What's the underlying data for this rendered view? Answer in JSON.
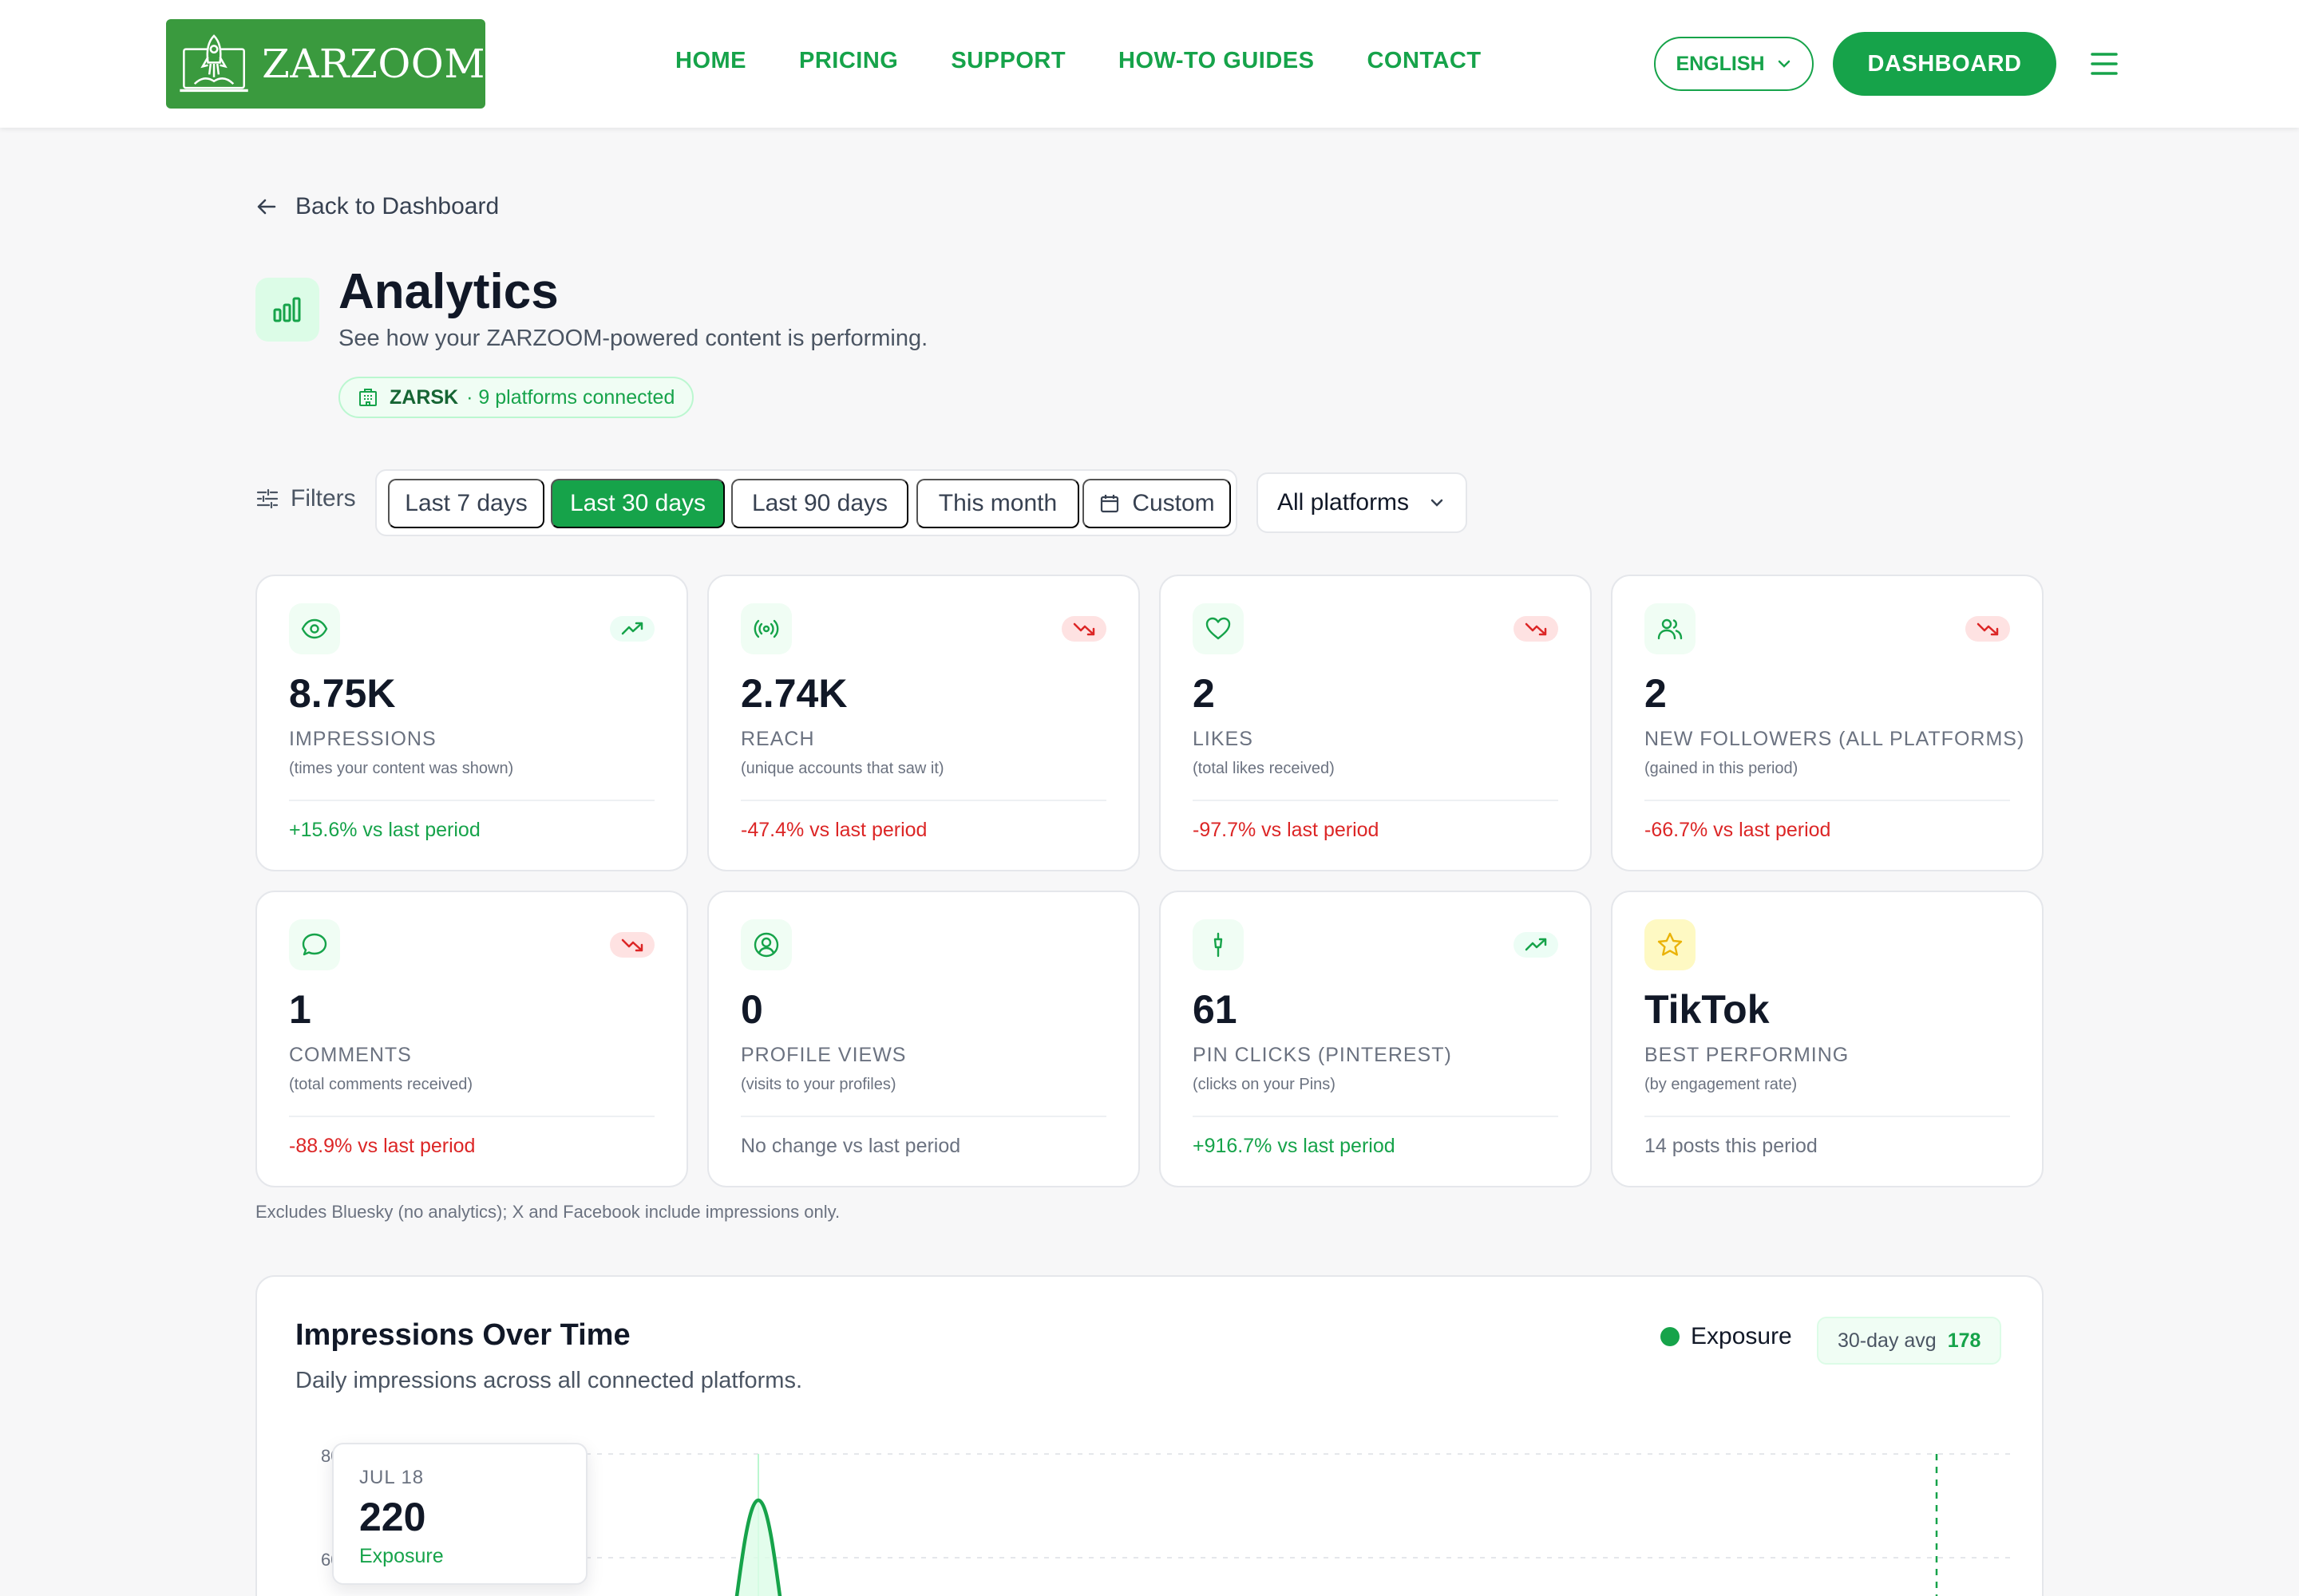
{
  "brand": {
    "logo_text": "ZARZOOM"
  },
  "nav": {
    "items": [
      {
        "label": "HOME"
      },
      {
        "label": "PRICING"
      },
      {
        "label": "SUPPORT"
      },
      {
        "label": "HOW-TO GUIDES"
      },
      {
        "label": "CONTACT"
      }
    ],
    "language": "ENGLISH",
    "dashboard_label": "DASHBOARD"
  },
  "page": {
    "back_label": "Back to Dashboard",
    "title": "Analytics",
    "subtitle": "See how your ZARZOOM-powered content is performing.",
    "org": {
      "name": "ZARSK",
      "meta": "· 9 platforms connected"
    }
  },
  "filters": {
    "label": "Filters",
    "ranges": [
      {
        "label": "Last 7 days",
        "active": false
      },
      {
        "label": "Last 30 days",
        "active": true
      },
      {
        "label": "Last 90 days",
        "active": false
      },
      {
        "label": "This month",
        "active": false
      },
      {
        "label": "Custom",
        "active": false
      }
    ],
    "platform": "All platforms"
  },
  "cards": [
    {
      "icon": "eye-icon",
      "trend": "up",
      "value": "8.75K",
      "label": "IMPRESSIONS",
      "desc": "(times your content was shown)",
      "change": "+15.6% vs last period",
      "change_type": "up"
    },
    {
      "icon": "broadcast-icon",
      "trend": "down",
      "value": "2.74K",
      "label": "REACH",
      "desc": "(unique accounts that saw it)",
      "change": "-47.4% vs last period",
      "change_type": "down"
    },
    {
      "icon": "heart-icon",
      "trend": "down",
      "value": "2",
      "label": "LIKES",
      "desc": "(total likes received)",
      "change": "-97.7% vs last period",
      "change_type": "down"
    },
    {
      "icon": "users-icon",
      "trend": "down",
      "value": "2",
      "label": "NEW FOLLOWERS (ALL PLATFORMS)",
      "desc": "(gained in this period)",
      "change": "-66.7% vs last period",
      "change_type": "down"
    },
    {
      "icon": "comment-icon",
      "trend": "down",
      "value": "1",
      "label": "COMMENTS",
      "desc": "(total comments received)",
      "change": "-88.9% vs last period",
      "change_type": "down"
    },
    {
      "icon": "user-circle-icon",
      "trend": "none",
      "value": "0",
      "label": "PROFILE VIEWS",
      "desc": "(visits to your profiles)",
      "change": "No change vs last period",
      "change_type": "flat"
    },
    {
      "icon": "pin-icon",
      "trend": "up",
      "value": "61",
      "label": "PIN CLICKS (PINTEREST)",
      "desc": "(clicks on your Pins)",
      "change": "+916.7% vs last period",
      "change_type": "up"
    },
    {
      "icon": "star-icon",
      "trend": "none",
      "value": "TikTok",
      "label": "BEST PERFORMING",
      "desc": "(by engagement rate)",
      "change": "14 posts this period",
      "change_type": "flat"
    }
  ],
  "footnote": "Excludes Bluesky (no analytics); X and Facebook include impressions only.",
  "chart": {
    "title": "Impressions Over Time",
    "subtitle": "Daily impressions across all connected platforms.",
    "legend": "Exposure",
    "avg_label": "30-day avg",
    "avg_value": "178",
    "tooltip": {
      "date": "JUL 18",
      "value": "220",
      "series": "Exposure"
    }
  },
  "colors": {
    "accent": "#16a34a",
    "negative": "#dc2626",
    "logo_bg": "#3a9a3e"
  }
}
